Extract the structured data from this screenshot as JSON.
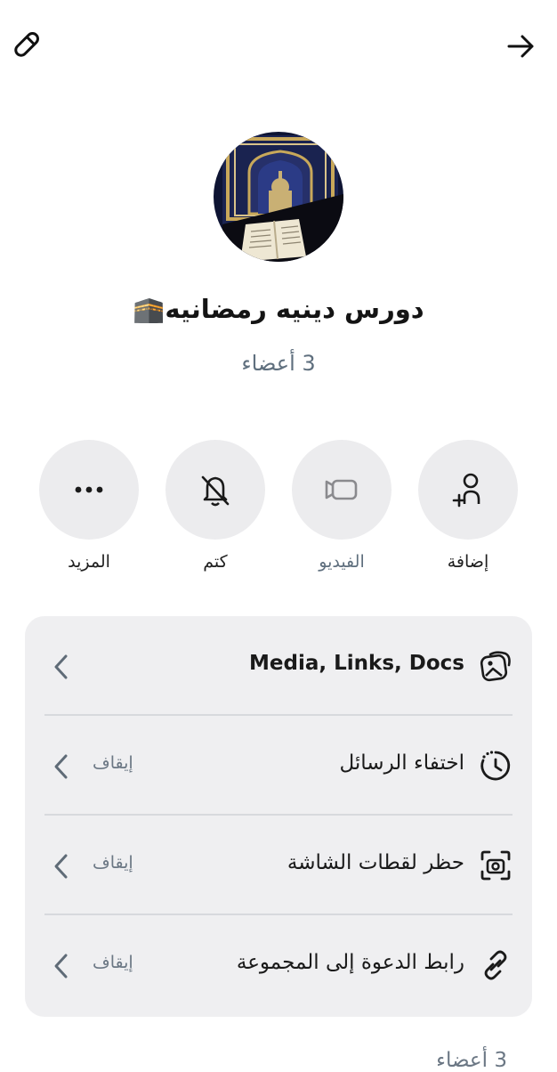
{
  "header": {
    "edit_icon": "pencil-icon",
    "forward_icon": "arrow-right-icon"
  },
  "group": {
    "name": "دورس دينيه رمضانيه🕋",
    "members": "3 أعضاء"
  },
  "actions": [
    {
      "label": "إضافة",
      "icon": "add-person-icon"
    },
    {
      "label": "الفيديو",
      "icon": "video-icon"
    },
    {
      "label": "كتم",
      "icon": "bell-slash-icon"
    },
    {
      "label": "المزيد",
      "icon": "more-dots-icon"
    }
  ],
  "settings": [
    {
      "label": "Media, Links, Docs",
      "value": "",
      "icon": "media-icon"
    },
    {
      "label": "اختفاء الرسائل",
      "value": "إيقاف",
      "icon": "timer-icon"
    },
    {
      "label": "حظر لقطات الشاشة",
      "value": "إيقاف",
      "icon": "screenshot-icon"
    },
    {
      "label": "رابط الدعوة إلى المجموعة",
      "value": "إيقاف",
      "icon": "link-icon"
    }
  ],
  "footer": {
    "members_text": "3 أعضاء"
  },
  "colors": {
    "background": "#ffffff",
    "card": "#efeff1",
    "circle": "#ececee",
    "muted_text": "#5f6f7e"
  }
}
